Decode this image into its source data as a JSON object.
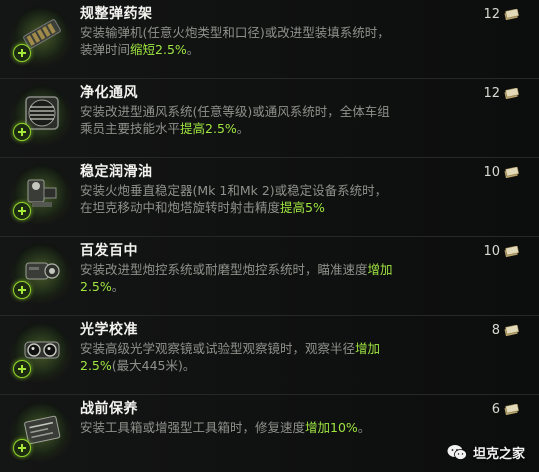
{
  "items": [
    {
      "title": "规整弹药架",
      "desc_before": "安装输弹机(任意火炮类型和口径)或改进型装填系统时，装弹时间",
      "desc_highlight": "缩短2.5%",
      "desc_after": "。",
      "cost": "12",
      "icon": "ammo-rack-icon"
    },
    {
      "title": "净化通风",
      "desc_before": "安装改进型通风系统(任意等级)或通风系统时，全体车组乘员主要技能水平",
      "desc_highlight": "提高2.5%",
      "desc_after": "。",
      "cost": "12",
      "icon": "ventilation-fan-icon"
    },
    {
      "title": "稳定润滑油",
      "desc_before": "安装火炮垂直稳定器(Mk 1和Mk 2)或稳定设备系统时，在坦克移动中和炮塔旋转时射击精度",
      "desc_highlight": "提高5%",
      "desc_after": "",
      "cost": "10",
      "icon": "stabilizer-icon"
    },
    {
      "title": "百发百中",
      "desc_before": "安装改进型炮控系统或耐磨型炮控系统时，瞄准速度",
      "desc_highlight": "增加2.5%",
      "desc_after": "。",
      "cost": "10",
      "icon": "gun-laying-drive-icon"
    },
    {
      "title": "光学校准",
      "desc_before": "安装高级光学观察镜或试验型观察镜时，观察半径",
      "desc_highlight": "增加2.5%",
      "desc_after": "(最大445米)。",
      "cost": "8",
      "icon": "optics-binoculars-icon"
    },
    {
      "title": "战前保养",
      "desc_before": "安装工具箱或增强型工具箱时，修复速度",
      "desc_highlight": "增加10%",
      "desc_after": "。",
      "cost": "6",
      "icon": "toolbox-icon"
    }
  ],
  "currency_icon": "bond-money-icon",
  "watermark": {
    "text": "坦克之家",
    "icon": "wechat-icon"
  },
  "colors": {
    "highlight": "#9fe640",
    "title": "#f2f2ee",
    "desc": "#8f918b",
    "badge": "#8fd12b"
  }
}
